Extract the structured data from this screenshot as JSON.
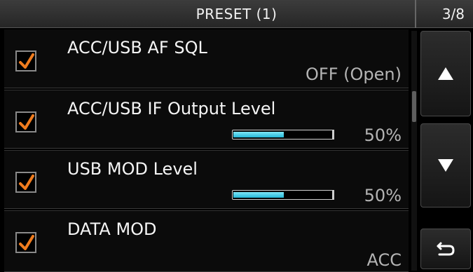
{
  "header": {
    "title": "PRESET (1)",
    "page": "3/8"
  },
  "rows": [
    {
      "label": "ACC/USB AF SQL",
      "value": "OFF (Open)",
      "checked": true
    },
    {
      "label": "ACC/USB IF Output Level",
      "value": "50%",
      "level": 0.5,
      "checked": true
    },
    {
      "label": "USB MOD Level",
      "value": "50%",
      "level": 0.5,
      "checked": true
    },
    {
      "label": "DATA MOD",
      "value": "ACC",
      "checked": true
    }
  ],
  "buttons": {
    "up": "up-arrow-icon",
    "down": "down-arrow-icon",
    "back": "return-icon"
  },
  "colors": {
    "check": "#f07c1e",
    "level_fill": "#2bbcdc"
  }
}
